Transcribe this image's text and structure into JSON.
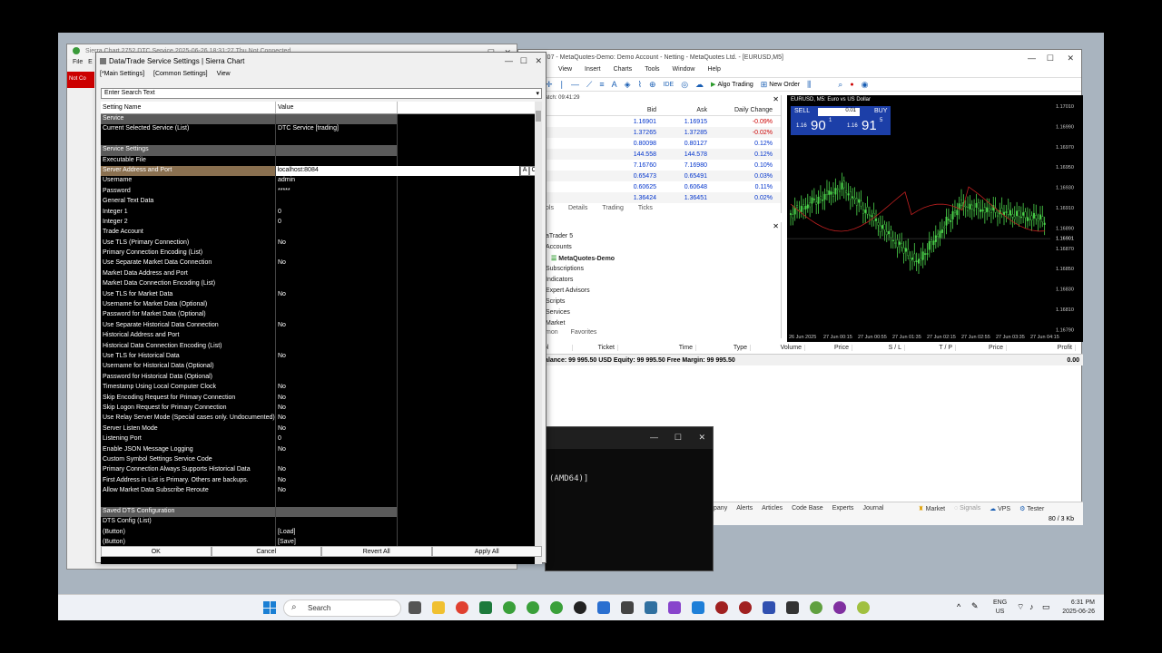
{
  "sierra_main": {
    "title": "Sierra Chart 2752 DTC Service 2025-06-26 18:31:27 Thu Not Connected",
    "menu": [
      "File",
      "E"
    ],
    "notconn": "Not Co"
  },
  "dialog": {
    "title": "Data/Trade Service Settings | Sierra Chart",
    "tabs": [
      "[*Main Settings]",
      "[Common Settings]",
      "View"
    ],
    "search_placeholder": "Enter Search Text",
    "col_setting": "Setting Name",
    "col_value": "Value",
    "edit_btn_a": "A",
    "edit_btn_c": "C",
    "rows": [
      {
        "name": "Service",
        "value": "",
        "type": "section"
      },
      {
        "name": "Current Selected Service (List)",
        "value": "DTC Service   [trading]"
      },
      {
        "name": "",
        "value": ""
      },
      {
        "name": "Service Settings",
        "value": "",
        "type": "section"
      },
      {
        "name": "Executable File",
        "value": ""
      },
      {
        "name": "Server Address and Port",
        "value": "localhost:8084",
        "type": "selected"
      },
      {
        "name": "Username",
        "value": "admin"
      },
      {
        "name": "Password",
        "value": "*****"
      },
      {
        "name": "General Text Data",
        "value": ""
      },
      {
        "name": "Integer 1",
        "value": "0"
      },
      {
        "name": "Integer 2",
        "value": "0"
      },
      {
        "name": "Trade Account",
        "value": ""
      },
      {
        "name": "Use TLS (Primary Connection)",
        "value": "No"
      },
      {
        "name": "Primary Connection Encoding (List)",
        "value": ""
      },
      {
        "name": "Use Separate Market Data Connection",
        "value": "No"
      },
      {
        "name": "Market Data Address and Port",
        "value": ""
      },
      {
        "name": "Market Data Connection Encoding (List)",
        "value": ""
      },
      {
        "name": "Use TLS for Market Data",
        "value": "No"
      },
      {
        "name": "Username for Market Data (Optional)",
        "value": ""
      },
      {
        "name": "Password for Market Data (Optional)",
        "value": ""
      },
      {
        "name": "Use Separate Historical Data Connection",
        "value": "No"
      },
      {
        "name": "Historical Address and Port",
        "value": ""
      },
      {
        "name": "Historical Data Connection Encoding (List)",
        "value": ""
      },
      {
        "name": "Use TLS for Historical Data",
        "value": "No"
      },
      {
        "name": "Username for Historical Data (Optional)",
        "value": ""
      },
      {
        "name": "Password for Historical Data (Optional)",
        "value": ""
      },
      {
        "name": "Timestamp Using Local Computer Clock",
        "value": "No"
      },
      {
        "name": "Skip Encoding Request for Primary Connection",
        "value": "No"
      },
      {
        "name": "Skip Logon Request for Primary Connection",
        "value": "No"
      },
      {
        "name": "Use Relay Server Mode (Special cases only. Undocumented)",
        "value": "No"
      },
      {
        "name": "Server Listen Mode",
        "value": "No"
      },
      {
        "name": "Listening Port",
        "value": "0"
      },
      {
        "name": "Enable JSON Message Logging",
        "value": "No"
      },
      {
        "name": "Custom Symbol Settings Service Code",
        "value": ""
      },
      {
        "name": "Primary Connection Always Supports Historical Data",
        "value": "No"
      },
      {
        "name": "First Address in List is Primary. Others are backups.",
        "value": "No"
      },
      {
        "name": "Allow Market Data Subscribe Reroute",
        "value": "No"
      },
      {
        "name": "",
        "value": ""
      },
      {
        "name": "Saved DTS Configuration",
        "value": "",
        "type": "section"
      },
      {
        "name": "DTS Config (List)",
        "value": ""
      },
      {
        "name": "(Button)",
        "value": "[Load]"
      },
      {
        "name": "(Button)",
        "value": "[Save]"
      }
    ],
    "buttons": [
      "OK",
      "Cancel",
      "Revert All",
      "Apply All"
    ]
  },
  "mt5": {
    "title": "51707 - MetaQuotes-Demo: Demo Account - Netting - MetaQuotes Ltd. - [EURUSD,M5]",
    "menu": [
      "View",
      "Insert",
      "Charts",
      "Tools",
      "Window",
      "Help"
    ],
    "toolbar": {
      "algo": "Algo Trading",
      "new_order": "New Order",
      "ide": "IDE"
    },
    "market_watch": {
      "header": "Watch: 09:41:29",
      "cols": [
        "Bid",
        "Ask",
        "Daily Change"
      ],
      "rows": [
        {
          "sym": "JSD",
          "bid": "1.16901",
          "ask": "1.16915",
          "chg": "-0.09%"
        },
        {
          "sym": "JSD",
          "bid": "1.37265",
          "ask": "1.37285",
          "chg": "-0.02%"
        },
        {
          "sym": "CHF",
          "bid": "0.80098",
          "ask": "0.80127",
          "chg": "0.12%"
        },
        {
          "sym": "PY",
          "bid": "144.558",
          "ask": "144.578",
          "chg": "0.12%"
        },
        {
          "sym": "CNH",
          "bid": "7.16760",
          "ask": "7.16980",
          "chg": "0.10%"
        },
        {
          "sym": "JSD",
          "bid": "0.65473",
          "ask": "0.65491",
          "chg": "0.03%"
        },
        {
          "sym": "JSD",
          "bid": "0.60625",
          "ask": "0.60648",
          "chg": "0.11%"
        },
        {
          "sym": "CAD",
          "bid": "1.36424",
          "ask": "1.36451",
          "chg": "0.02%"
        }
      ],
      "tabs": [
        "ols",
        "Details",
        "Trading",
        "Ticks"
      ]
    },
    "navigator": {
      "header": "or",
      "items": [
        "aTrader 5",
        "Accounts",
        "MetaQuotes-Demo",
        "Subscriptions",
        "Indicators",
        "Expert Advisors",
        "Scripts",
        "Services",
        "Market"
      ],
      "tabs": [
        "mon",
        "Favorites"
      ]
    },
    "chart": {
      "symbol": "EURUSD, M5:  Euro vs US Dollar",
      "sell": "SELL",
      "buy": "BUY",
      "lot": "0.01",
      "sell_big": "90",
      "sell_small": "1.16",
      "sell_sup": "1",
      "buy_big": "91",
      "buy_small": "1.16",
      "buy_sup": "5",
      "prices": [
        "1.17010",
        "1.16990",
        "1.16970",
        "1.16950",
        "1.16930",
        "1.16910",
        "1.16890",
        "1.16870",
        "1.16850",
        "1.16830",
        "1.16810",
        "1.16790"
      ],
      "current_price": "1.16901",
      "times": [
        "26 Jun 2025",
        "27 Jun 00:15",
        "27 Jun 00:55",
        "27 Jun 01:35",
        "27 Jun 02:15",
        "27 Jun 02:55",
        "27 Jun 03:35",
        "27 Jun 04:15"
      ]
    },
    "toolbox": {
      "cols": [
        "bol",
        "Ticket",
        "Time",
        "Type",
        "Volume",
        "Price",
        "S / L",
        "T / P",
        "Price",
        "Profit"
      ],
      "balance": "Balance: 99 995.50 USD  Equity: 99 995.50  Free Margin: 99 995.50",
      "profit": "0.00",
      "bottom_tabs": [
        "ar",
        "Company",
        "Alerts",
        "Articles",
        "Code Base",
        "Experts",
        "Journal"
      ],
      "right": {
        "market": "Market",
        "signals": "Signals",
        "vps": "VPS",
        "tester": "Tester"
      },
      "status_left": "efault",
      "status_right": "80 / 3 Kb"
    }
  },
  "console": {
    "text": "(AMD64)]"
  },
  "taskbar": {
    "search": "Search",
    "lang1": "ENG",
    "lang2": "US",
    "time": "6:31 PM",
    "date": "2025-06-26"
  }
}
